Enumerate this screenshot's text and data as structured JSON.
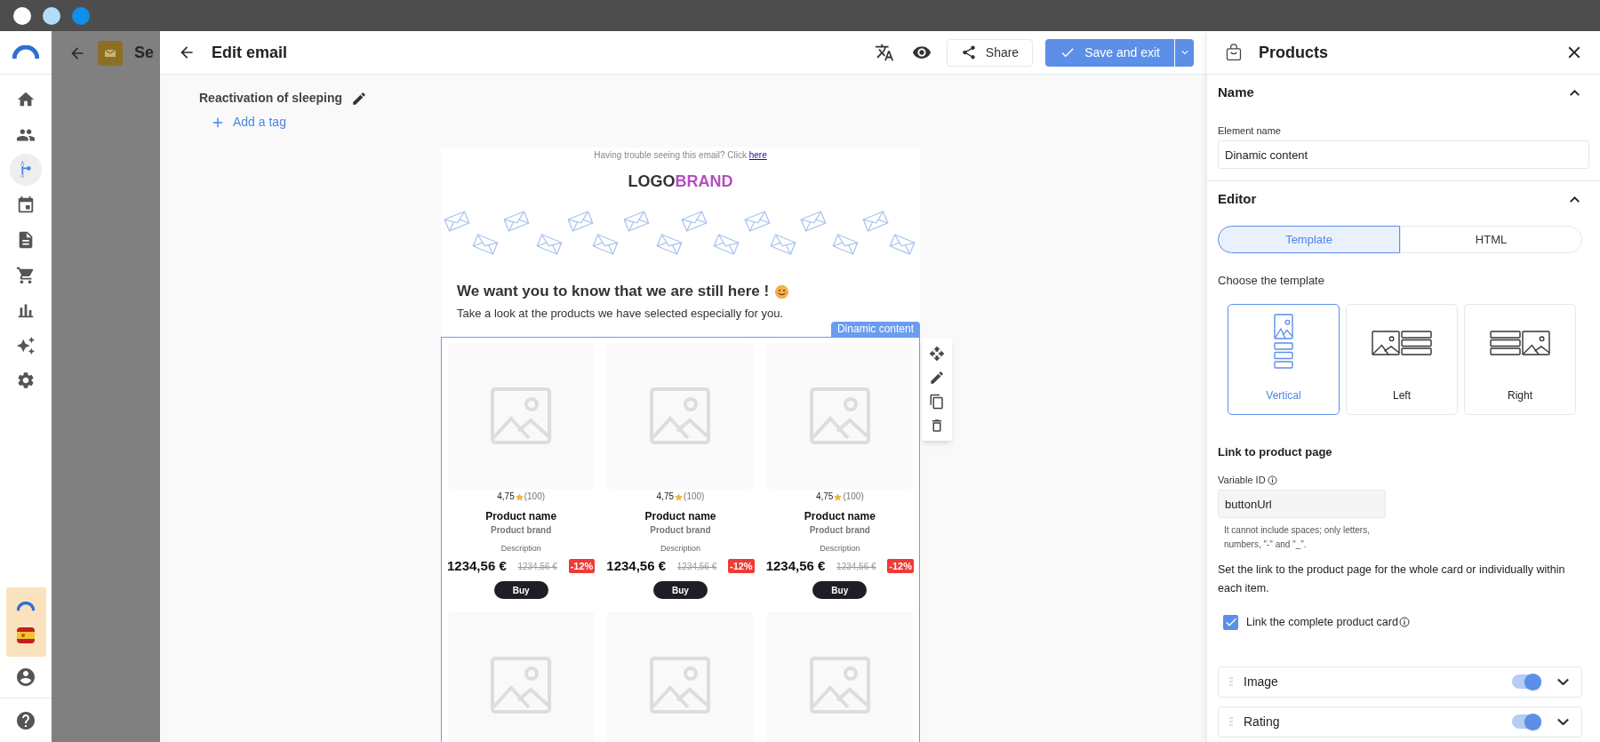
{
  "window_controls": [
    {
      "color": "#ffffff"
    },
    {
      "color": "#b3dcfb"
    },
    {
      "color": "#0f8fe8"
    }
  ],
  "nav": {
    "items": [
      {
        "kind": "home",
        "selected": false
      },
      {
        "kind": "contacts",
        "selected": false
      },
      {
        "kind": "flows",
        "selected": true
      },
      {
        "kind": "calendar",
        "selected": false
      },
      {
        "kind": "documents",
        "selected": false
      },
      {
        "kind": "cart",
        "selected": false
      },
      {
        "kind": "reports",
        "selected": false
      },
      {
        "kind": "ai",
        "selected": false
      },
      {
        "kind": "settings",
        "selected": false
      }
    ]
  },
  "background_page": {
    "title": "Se"
  },
  "editor": {
    "title": "Edit email",
    "share_label": "Share",
    "save_label": "Save and exit",
    "email_name": "Reactivation of sleeping",
    "add_tag_label": "Add a tag"
  },
  "email": {
    "preheader": "Having trouble seeing this email? Click",
    "preheader_link": "here",
    "logo": "LOGO",
    "logo_accent": "BRAND",
    "heading": "We want you to know that we are still here !",
    "subheading": "Take a look at the products we have selected especially for you.",
    "block_label": "Dinamic content",
    "products": [
      {
        "kind": "full",
        "rating": "4,75",
        "reviews": "(100)",
        "name": "Product name",
        "brand": "Product brand",
        "description": "Description",
        "price": "1234,56 €",
        "old_price": "1234,56 €",
        "discount": "-12%",
        "button": "Buy"
      },
      {
        "kind": "full",
        "rating": "4,75",
        "reviews": "(100)",
        "name": "Product name",
        "brand": "Product brand",
        "description": "Description",
        "price": "1234,56 €",
        "old_price": "1234,56 €",
        "discount": "-12%",
        "button": "Buy"
      },
      {
        "kind": "full",
        "rating": "4,75",
        "reviews": "(100)",
        "name": "Product name",
        "brand": "Product brand",
        "description": "Description",
        "price": "1234,56 €",
        "old_price": "1234,56 €",
        "discount": "-12%",
        "button": "Buy"
      },
      {
        "kind": "image_only"
      },
      {
        "kind": "image_only"
      },
      {
        "kind": "image_only"
      }
    ]
  },
  "panel": {
    "title": "Products",
    "sections": [
      {
        "kind": "name",
        "title": "Name",
        "expanded": true,
        "field_label": "Element name",
        "field_value": "Dinamic content"
      },
      {
        "kind": "editor",
        "title": "Editor",
        "expanded": true,
        "modes": [
          {
            "label": "Template",
            "selected": true
          },
          {
            "label": "HTML",
            "selected": false
          }
        ],
        "choose_label": "Choose the template",
        "templates": [
          {
            "kind": "vertical",
            "label": "Vertical",
            "selected": true
          },
          {
            "kind": "left",
            "label": "Left",
            "selected": false
          },
          {
            "kind": "right",
            "label": "Right",
            "selected": false
          }
        ],
        "link_heading": "Link to product page",
        "variable_label": "Variable ID",
        "variable_value": "buttonUrl",
        "variable_hint": "It cannot include spaces; only letters, numbers, \"-\" and \"_\".",
        "link_description": "Set the link to the product page for the whole card or individually within each item.",
        "link_card": {
          "label": "Link the complete product card",
          "checked": true
        },
        "elements": [
          {
            "label": "Image",
            "on": true,
            "expanded": false
          },
          {
            "label": "Rating",
            "on": true,
            "expanded": false
          }
        ]
      }
    ]
  }
}
